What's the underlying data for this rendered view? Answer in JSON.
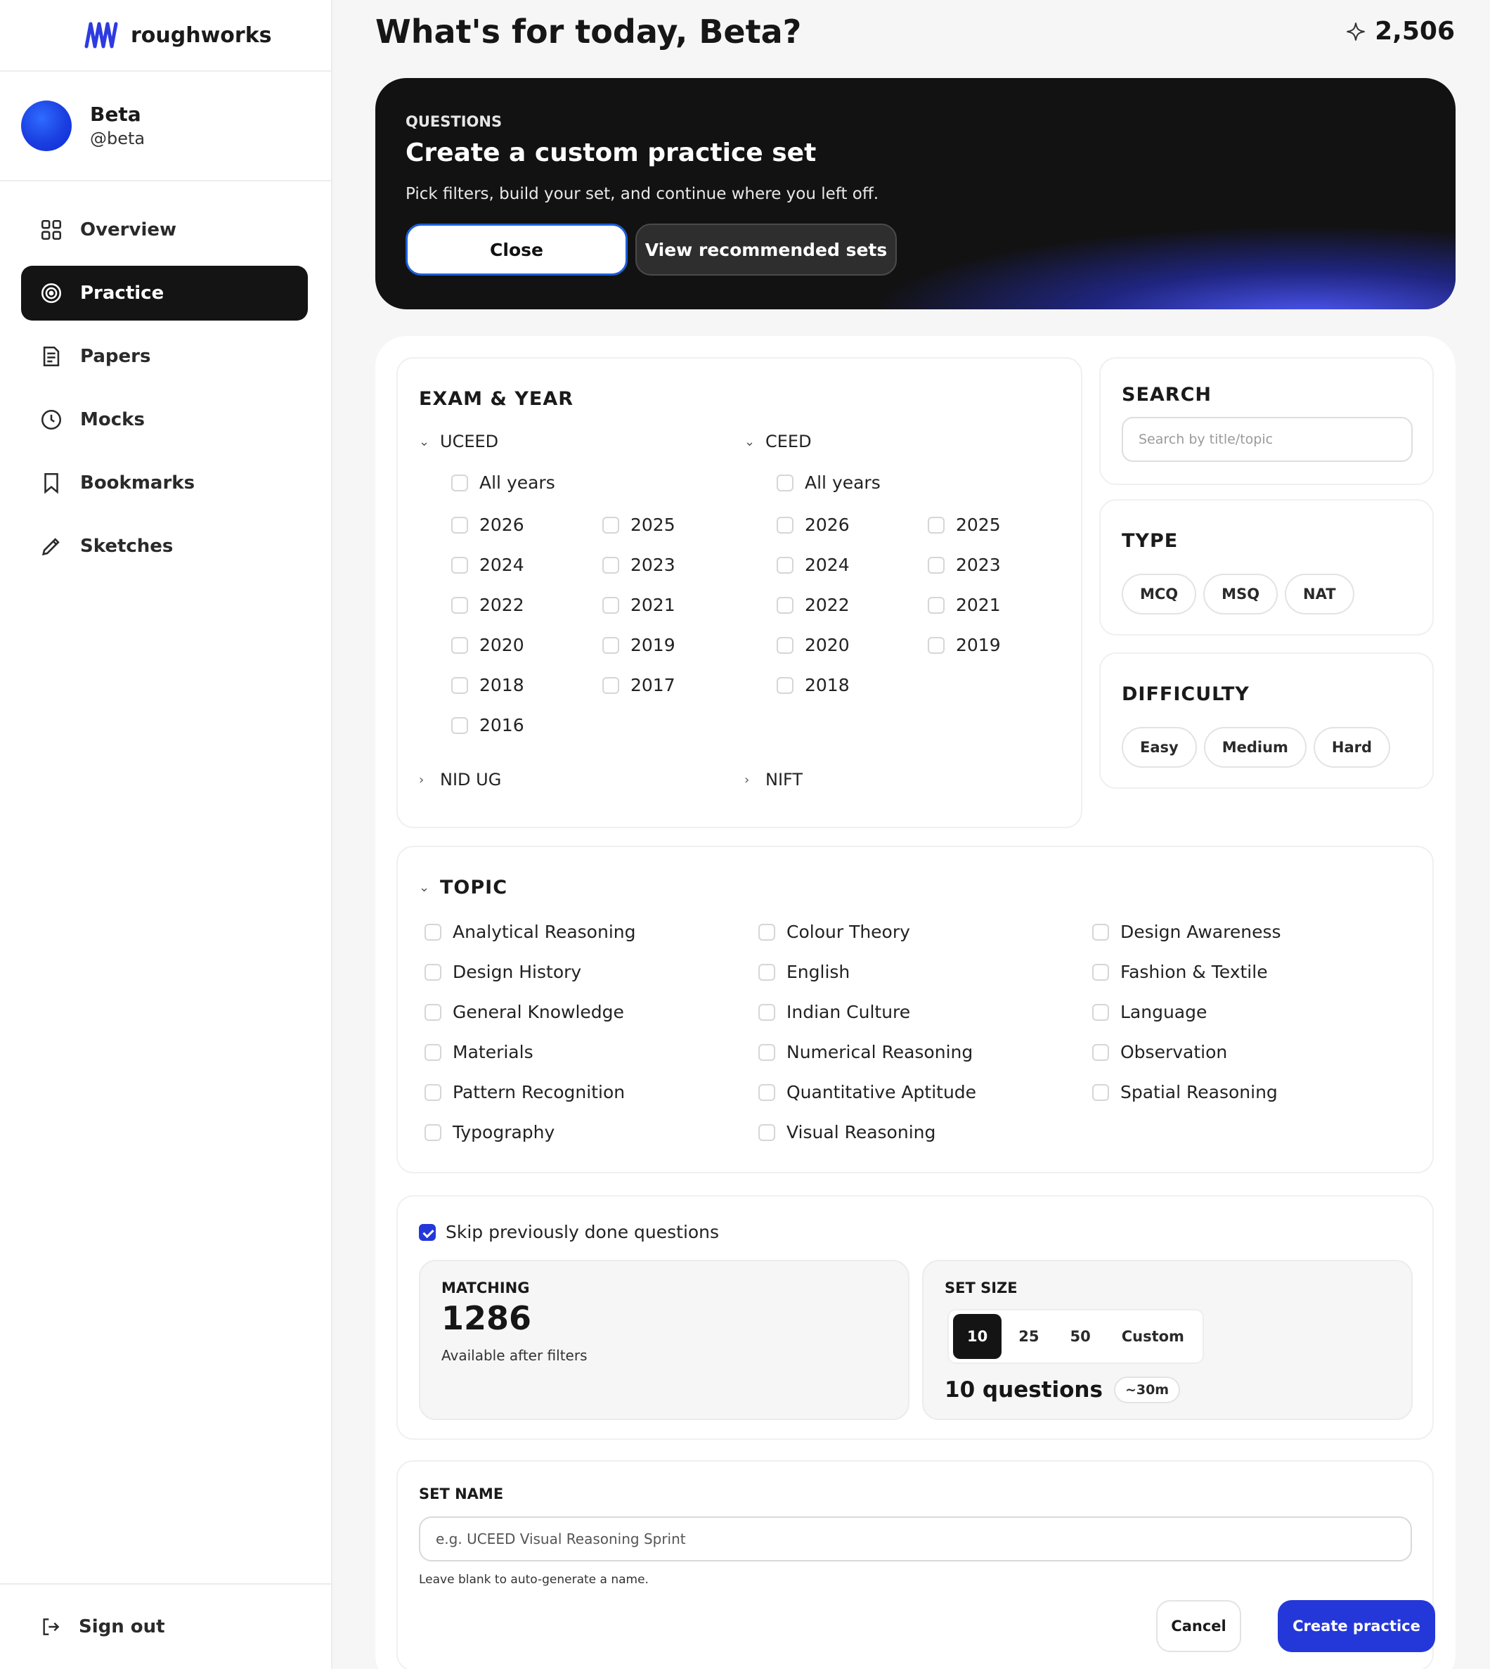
{
  "brand": {
    "name": "roughworks",
    "logo_icon": "wave-logo-icon",
    "color": "#2d3be0"
  },
  "user": {
    "name": "Beta",
    "handle": "@beta"
  },
  "nav": [
    {
      "label": "Overview",
      "icon": "grid-icon",
      "active": false
    },
    {
      "label": "Practice",
      "icon": "target-icon",
      "active": true
    },
    {
      "label": "Papers",
      "icon": "document-icon",
      "active": false
    },
    {
      "label": "Mocks",
      "icon": "clock-icon",
      "active": false
    },
    {
      "label": "Bookmarks",
      "icon": "bookmark-icon",
      "active": false
    },
    {
      "label": "Sketches",
      "icon": "pencil-icon",
      "active": false
    }
  ],
  "sign_out": "Sign out",
  "header": {
    "greeting": "What's for today, Beta?",
    "points": "2,506"
  },
  "hero": {
    "eyebrow": "QUESTIONS",
    "title": "Create a custom practice set",
    "subtitle": "Pick filters, build your set, and continue where you left off.",
    "close_label": "Close",
    "recommended_label": "View recommended sets"
  },
  "exam_year": {
    "title": "EXAM & YEAR",
    "groups": [
      {
        "name": "UCEED",
        "expanded": true,
        "all_label": "All years",
        "years": [
          "2026",
          "2025",
          "2024",
          "2023",
          "2022",
          "2021",
          "2020",
          "2019",
          "2018",
          "2017",
          "2016"
        ]
      },
      {
        "name": "CEED",
        "expanded": true,
        "all_label": "All years",
        "years": [
          "2026",
          "2025",
          "2024",
          "2023",
          "2022",
          "2021",
          "2020",
          "2019",
          "2018"
        ]
      },
      {
        "name": "NID UG",
        "expanded": false
      },
      {
        "name": "NIFT",
        "expanded": false
      }
    ]
  },
  "search": {
    "title": "SEARCH",
    "placeholder": "Search by title/topic"
  },
  "type": {
    "title": "TYPE",
    "options": [
      "MCQ",
      "MSQ",
      "NAT"
    ]
  },
  "difficulty": {
    "title": "DIFFICULTY",
    "options": [
      "Easy",
      "Medium",
      "Hard"
    ]
  },
  "topic": {
    "title": "TOPIC",
    "items": [
      "Analytical Reasoning",
      "Colour Theory",
      "Design Awareness",
      "Design History",
      "English",
      "Fashion & Textile",
      "General Knowledge",
      "Indian Culture",
      "Language",
      "Materials",
      "Numerical Reasoning",
      "Observation",
      "Pattern Recognition",
      "Quantitative Aptitude",
      "Spatial Reasoning",
      "Typography",
      "Visual Reasoning"
    ]
  },
  "options": {
    "skip_label": "Skip previously done questions",
    "skip_checked": true,
    "matching": {
      "title": "MATCHING",
      "count": "1286",
      "caption": "Available after filters"
    },
    "set_size": {
      "title": "SET SIZE",
      "options": [
        "10",
        "25",
        "50",
        "Custom"
      ],
      "selected": "10",
      "summary": "10 questions",
      "time": "~30m"
    }
  },
  "set_name": {
    "title": "SET NAME",
    "placeholder": "e.g. UCEED Visual Reasoning Sprint",
    "hint": "Leave blank to auto-generate a name.",
    "cancel_label": "Cancel",
    "create_label": "Create practice"
  },
  "colors": {
    "accent": "#2438d9",
    "dark": "#141414",
    "background": "#f6f6f6"
  }
}
